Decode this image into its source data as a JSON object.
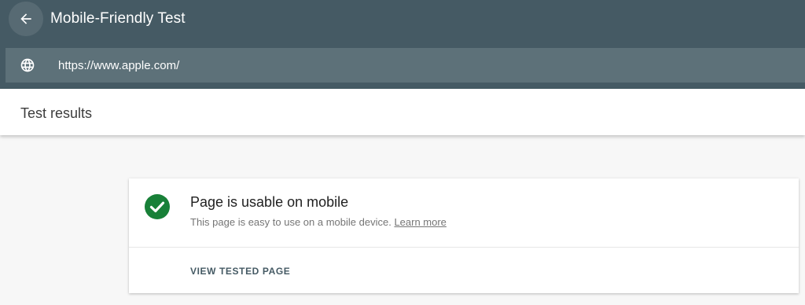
{
  "app": {
    "title": "Mobile-Friendly Test",
    "back_icon": "arrow-left-icon"
  },
  "url_bar": {
    "icon": "globe-icon",
    "value": "https://www.apple.com/"
  },
  "results": {
    "title": "Test results"
  },
  "result_card": {
    "status_icon": "check-circle-icon",
    "status_color": "#188038",
    "title": "Page is usable on mobile",
    "description": "This page is easy to use on a mobile device.",
    "learn_more": "Learn more",
    "view_button": "VIEW TESTED PAGE"
  },
  "colors": {
    "header_bg": "#455a64",
    "url_bar_bg": "#5d7179",
    "page_bg": "#f7f7f7"
  }
}
